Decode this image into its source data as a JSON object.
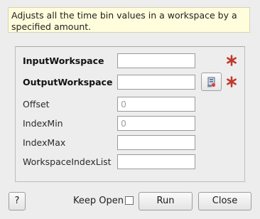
{
  "description": "Adjusts all the time bin values in a workspace by a specified amount.",
  "properties": [
    {
      "label": "InputWorkspace",
      "value": "",
      "placeholder": "",
      "required": true
    },
    {
      "label": "OutputWorkspace",
      "value": "",
      "placeholder": "",
      "required": true,
      "browse_icon": "workspace-browse-icon"
    },
    {
      "label": "Offset",
      "value": "",
      "placeholder": "0"
    },
    {
      "label": "IndexMin",
      "value": "",
      "placeholder": "0"
    },
    {
      "label": "IndexMax",
      "value": "",
      "placeholder": ""
    },
    {
      "label": "WorkspaceIndexList",
      "value": "",
      "placeholder": ""
    }
  ],
  "footer": {
    "help_label": "?",
    "keep_open_label": "Keep Open",
    "keep_open_checked": false,
    "run_label": "Run",
    "close_label": "Close"
  },
  "colors": {
    "required_star": "#c0392b",
    "description_bg": "#fffddc"
  }
}
